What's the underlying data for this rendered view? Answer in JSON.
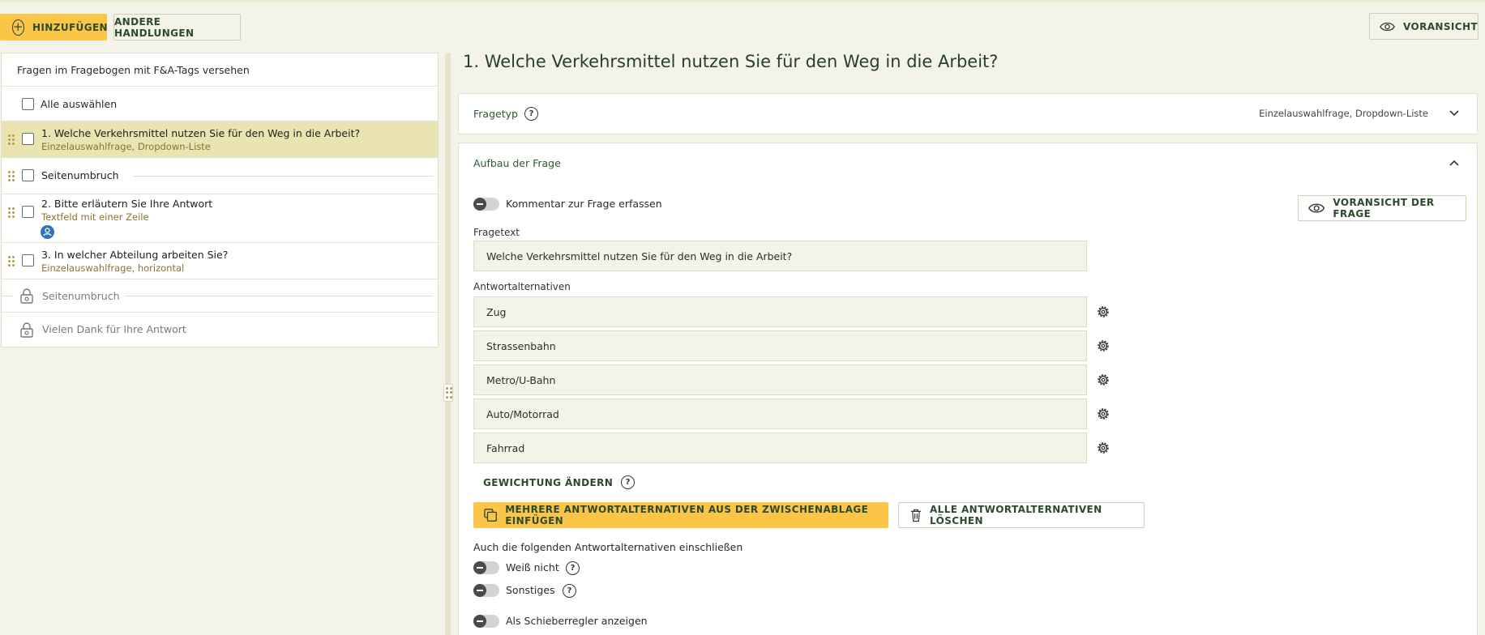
{
  "toolbar": {
    "add_label": "HINZUFÜGEN",
    "other_actions_label": "ANDERE HANDLUNGEN",
    "preview_label": "VORANSICHT"
  },
  "sidebar": {
    "header": "Fragen im Fragebogen mit F&A-Tags versehen",
    "select_all": "Alle auswählen",
    "items": [
      {
        "title": "1.  Welche Verkehrsmittel nutzen Sie für den Weg in die Arbeit?",
        "subtitle": "Einzelauswahlfrage, Dropdown-Liste"
      },
      {
        "title": "Seitenumbruch"
      },
      {
        "title": "2.  Bitte erläutern Sie Ihre Antwort",
        "subtitle": "Textfeld mit einer Zeile"
      },
      {
        "title": "3.  In welcher Abteilung arbeiten Sie?",
        "subtitle": "Einzelauswahlfrage, horizontal"
      }
    ],
    "locked_items": [
      "Seitenumbruch",
      "Vielen Dank für Ihre Antwort"
    ]
  },
  "editor": {
    "title": "1. Welche Verkehrsmittel nutzen Sie für den Weg in die Arbeit?",
    "question_type_label": "Fragetyp",
    "question_type_value": "Einzelauswahlfrage, Dropdown-Liste",
    "structure_label": "Aufbau der Frage",
    "comment_toggle_label": "Kommentar zur Frage erfassen",
    "question_preview_label": "VORANSICHT DER FRAGE",
    "question_text_label": "Fragetext",
    "question_text_value": "Welche Verkehrsmittel nutzen Sie für den Weg in die Arbeit?",
    "answers_label": "Antwortalternativen",
    "answers": [
      "Zug",
      "Strassenbahn",
      "Metro/U-Bahn",
      "Auto/Motorrad",
      "Fahrrad"
    ],
    "weighting_label": "GEWICHTUNG ÄNDERN",
    "paste_label": "MEHRERE ANTWORTALTERNATIVEN AUS DER ZWISCHENABLAGE EINFÜGEN",
    "delete_all_label": "ALLE ANTWORTALTERNATIVEN LÖSCHEN",
    "include_label": "Auch die folgenden Antwortalternativen einschließen",
    "dont_know_label": "Weiß nicht",
    "other_label": "Sonstiges",
    "slider_label": "Als Schieberregler anzeigen"
  },
  "colors": {
    "accent_yellow": "#fbc547",
    "dark_green": "#2d5a2f",
    "selected_row": "#e9e4b2",
    "page_bg": "#f3f3e7",
    "avatar_blue": "#2f76b8"
  }
}
